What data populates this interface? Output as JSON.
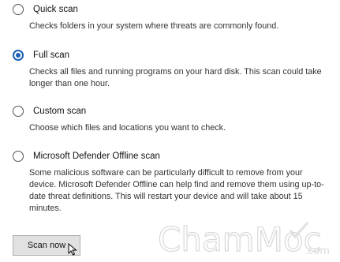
{
  "options": [
    {
      "label": "Quick scan",
      "description": "Checks folders in your system where threats are commonly found.",
      "selected": false
    },
    {
      "label": "Full scan",
      "description": "Checks all files and running programs on your hard disk. This scan could take longer than one hour.",
      "selected": true
    },
    {
      "label": "Custom scan",
      "description": "Choose which files and locations you want to check.",
      "selected": false
    },
    {
      "label": "Microsoft Defender Offline scan",
      "description": "Some malicious software can be particularly difficult to remove from your device. Microsoft Defender Offline can help find and remove them using up-to-date threat definitions. This will restart your device and will take about 15 minutes.",
      "selected": false
    }
  ],
  "scan_button": {
    "label": "Scan now"
  },
  "watermark": {
    "text": "ChamMoc",
    "suffix": ".com"
  },
  "colors": {
    "radio_selected": "#1a5fb4",
    "button_bg": "#e1e1e1"
  },
  "icons": {
    "cursor": "mouse-pointer-icon"
  }
}
